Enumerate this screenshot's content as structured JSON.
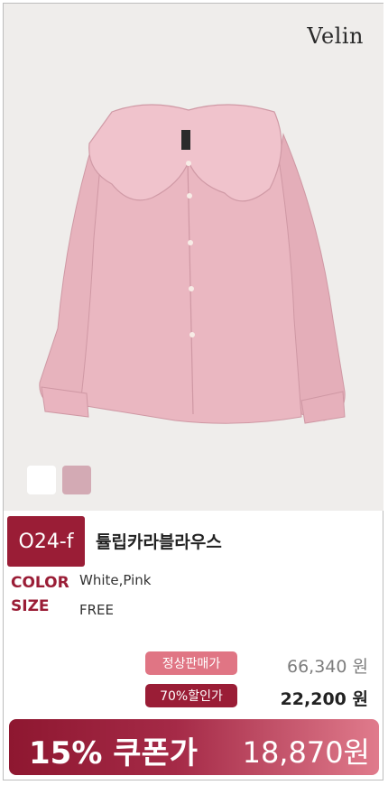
{
  "brand": {
    "logo": "Velin"
  },
  "swatches": {
    "colors": [
      "#ffffff",
      "#d3aab4"
    ]
  },
  "product": {
    "code": "O24-f",
    "name": "튤립카라블라우스",
    "color_label": "COLOR",
    "color_value": "White,Pink",
    "size_label": "SIZE",
    "size_value": "FREE"
  },
  "pricing": {
    "normal_label": "정상판매가",
    "normal_price": "66,340 원",
    "discount_label": "70%할인가",
    "discount_price": "22,200 원"
  },
  "coupon": {
    "label": "15% 쿠폰가",
    "price": "18,870원"
  }
}
